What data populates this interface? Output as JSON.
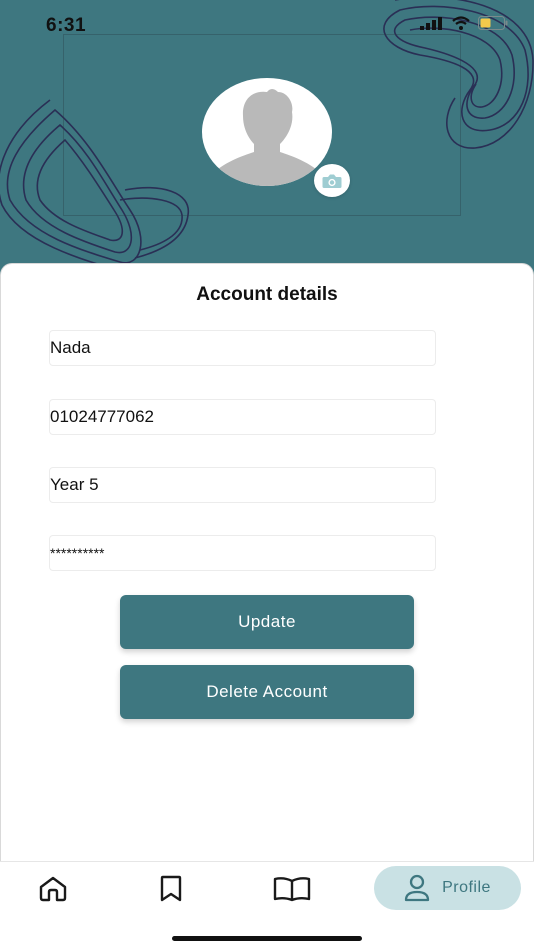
{
  "status_bar": {
    "time": "6:31",
    "icons": [
      "signal-icon",
      "wifi-icon",
      "battery-icon"
    ],
    "battery_color": "#f2c94c"
  },
  "header": {
    "background": "#3e7780",
    "avatar_icon": "user-silhouette-icon",
    "camera_icon": "camera-icon"
  },
  "account": {
    "title": "Account details",
    "fields": {
      "name": "Nada",
      "phone": "01024777062",
      "year": "Year 5",
      "password": "**********"
    },
    "update_label": "Update",
    "delete_label": "Delete Account"
  },
  "tabbar": {
    "items": [
      {
        "icon": "home-icon"
      },
      {
        "icon": "bookmark-icon"
      },
      {
        "icon": "book-open-icon"
      },
      {
        "icon": "user-icon",
        "label": "Profile",
        "active": true
      }
    ],
    "active_bg": "#c9e1e4",
    "accent": "#3e7780"
  }
}
